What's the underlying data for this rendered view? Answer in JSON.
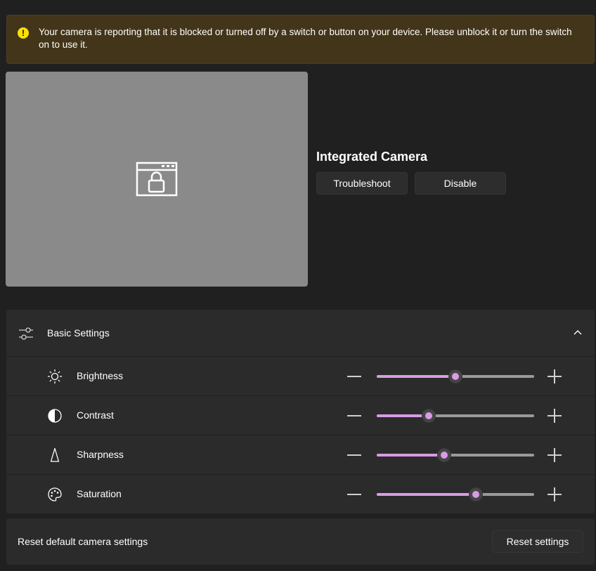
{
  "banner": {
    "icon": "warning-icon",
    "glyph": "!",
    "message": "Your camera is reporting that it is blocked or turned off by a switch or button on your device. Please unblock it or turn the switch on to use it.",
    "color": "#433519"
  },
  "preview": {
    "icon": "locked-window-icon",
    "background": "#8a8a8a"
  },
  "camera": {
    "name": "Integrated Camera",
    "troubleshoot_label": "Troubleshoot",
    "disable_label": "Disable"
  },
  "basic_settings": {
    "title": "Basic Settings",
    "expanded": true,
    "accent": "#d99be6",
    "rows": [
      {
        "label": "Brightness",
        "icon": "sun-icon",
        "value_fraction": 0.5
      },
      {
        "label": "Contrast",
        "icon": "contrast-icon",
        "value_fraction": 0.33
      },
      {
        "label": "Sharpness",
        "icon": "sharpness-icon",
        "value_fraction": 0.43
      },
      {
        "label": "Saturation",
        "icon": "palette-icon",
        "value_fraction": 0.63
      }
    ]
  },
  "reset": {
    "label": "Reset default camera settings",
    "button_label": "Reset settings"
  }
}
